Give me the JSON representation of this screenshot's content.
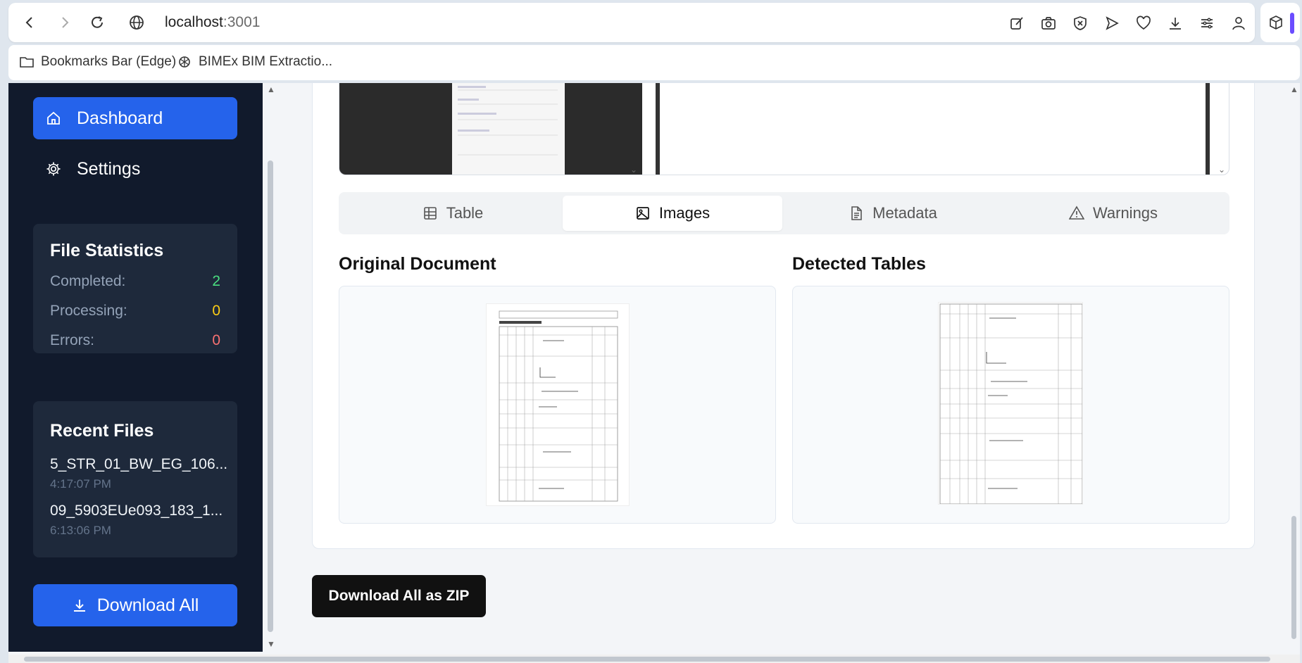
{
  "browser": {
    "url_host": "localhost",
    "url_port": ":3001",
    "bookmarks": [
      {
        "label": "Bookmarks Bar (Edge)",
        "icon": "folder-icon"
      },
      {
        "label": "BIMEx BIM Extractio...",
        "icon": "openai-icon"
      }
    ]
  },
  "sidebar": {
    "nav": [
      {
        "label": "Dashboard",
        "icon": "home-icon",
        "active": true
      },
      {
        "label": "Settings",
        "icon": "gear-icon",
        "active": false
      }
    ],
    "file_statistics": {
      "title": "File Statistics",
      "rows": [
        {
          "label": "Completed:",
          "value": "2",
          "color": "#4ade80"
        },
        {
          "label": "Processing:",
          "value": "0",
          "color": "#facc15"
        },
        {
          "label": "Errors:",
          "value": "0",
          "color": "#f87171"
        }
      ]
    },
    "recent_files": {
      "title": "Recent Files",
      "items": [
        {
          "name": "5_STR_01_BW_EG_106...",
          "time": "4:17:07 PM"
        },
        {
          "name": "09_5903EUe093_183_1...",
          "time": "6:13:06 PM"
        }
      ]
    },
    "download_all_label": "Download All"
  },
  "main": {
    "tabs": [
      {
        "label": "Table",
        "icon": "table-icon",
        "active": false
      },
      {
        "label": "Images",
        "icon": "image-icon",
        "active": true
      },
      {
        "label": "Metadata",
        "icon": "file-text-icon",
        "active": false
      },
      {
        "label": "Warnings",
        "icon": "alert-triangle-icon",
        "active": false
      }
    ],
    "original_document_title": "Original Document",
    "detected_tables_title": "Detected Tables",
    "download_zip_label": "Download All as ZIP"
  },
  "colors": {
    "sidebar_bg": "#111a2c",
    "accent": "#2563eb",
    "card_bg": "#1e293b"
  }
}
